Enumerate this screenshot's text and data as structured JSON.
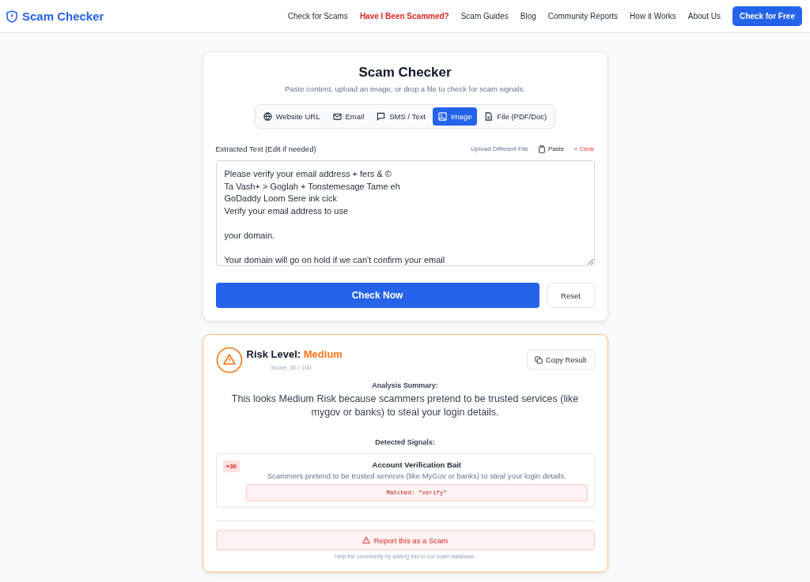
{
  "brand": "Scam Checker",
  "nav": [
    {
      "label": "Check for Scams",
      "highlighted": false
    },
    {
      "label": "Have I Been Scammed?",
      "highlighted": true
    },
    {
      "label": "Scam Guides",
      "highlighted": false
    },
    {
      "label": "Blog",
      "highlighted": false
    },
    {
      "label": "Community Reports",
      "highlighted": false
    },
    {
      "label": "How it Works",
      "highlighted": false
    },
    {
      "label": "About Us",
      "highlighted": false
    }
  ],
  "cta": "Check for Free",
  "checker": {
    "title": "Scam Checker",
    "subtitle": "Paste content, upload an image, or drop a file to check for scam signals.",
    "tabs": [
      {
        "label": "Website URL",
        "selected": false
      },
      {
        "label": "Email",
        "selected": false
      },
      {
        "label": "SMS / Text",
        "selected": false
      },
      {
        "label": "Image",
        "selected": true
      },
      {
        "label": "File (PDF/Doc)",
        "selected": false
      }
    ],
    "field_label": "Extracted Text (Edit if needed)",
    "upload": "Upload Different File",
    "paste": "Paste",
    "clear": "× Clear",
    "text": "Please verify your email address + fers & ©\nTa Vash+ > Goglah + Tonstemesage Tame eh\nGoDaddy Loom Sere ink cick\nVerify your email address to use\n\nyour domain.\n\nYour domain will go on hold if we can't confirm your email",
    "check": "Check Now",
    "reset": "Reset"
  },
  "result": {
    "risk_label": "Risk Level:",
    "risk": "Medium",
    "score": "Score: 30 / 100",
    "copy": "Copy Result",
    "summary_heading": "Analysis Summary:",
    "summary": "This looks Medium Risk because scammers pretend to be trusted services (like mygov or banks) to steal your login details.",
    "signals_heading": "Detected Signals:",
    "signals": [
      {
        "points": "+30",
        "title": "Account Verification Bait",
        "description": "Scammers pretend to be trusted services (like MyGov or banks) to steal your login details.",
        "matched": "Matched: \"verify\""
      }
    ],
    "report": "Report this as a Scam",
    "report_note": "Help the community by adding this to our scam database."
  }
}
